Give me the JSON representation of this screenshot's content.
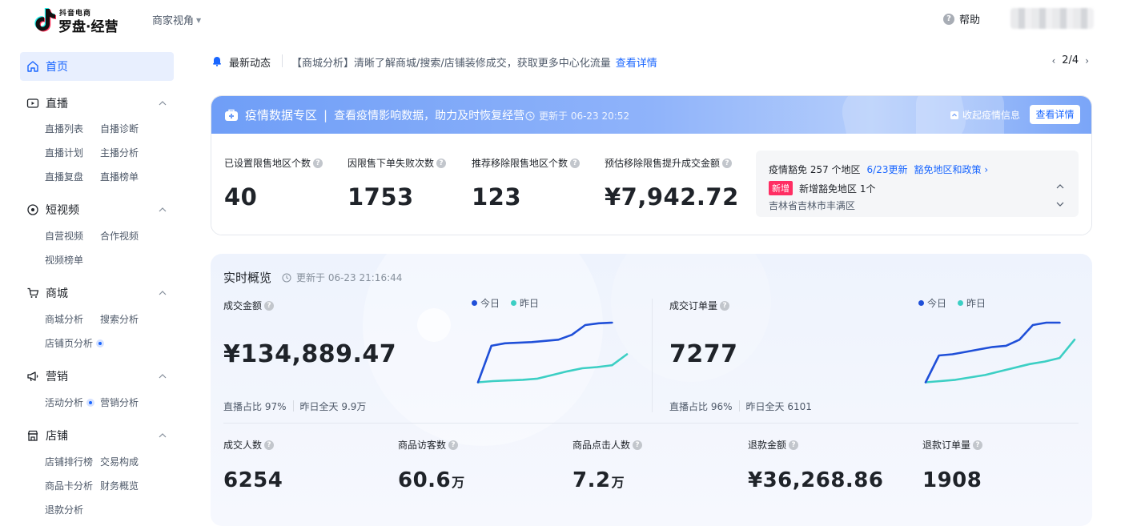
{
  "header": {
    "logo_top": "抖音电商",
    "logo_main": "罗盘·经营",
    "view_switch": "商家视角",
    "help": "帮助"
  },
  "sidebar": {
    "home": "首页",
    "groups": [
      {
        "title": "直播",
        "icon": "tv-icon",
        "items": [
          "直播列表",
          "自播诊断",
          "直播计划",
          "主播分析",
          "直播复盘",
          "直播榜单"
        ]
      },
      {
        "title": "短视频",
        "icon": "video-icon",
        "items": [
          "自营视频",
          "合作视频",
          "视频榜单"
        ]
      },
      {
        "title": "商城",
        "icon": "cart-icon",
        "items": [
          "商城分析",
          "搜索分析",
          "店铺页分析"
        ]
      },
      {
        "title": "营销",
        "icon": "megaphone-icon",
        "items": [
          "活动分析",
          "营销分析"
        ]
      },
      {
        "title": "店铺",
        "icon": "shop-icon",
        "items": [
          "店铺排行榜",
          "交易构成",
          "商品卡分析",
          "财务概览",
          "退款分析"
        ]
      }
    ]
  },
  "news": {
    "label": "最新动态",
    "text": "【商城分析】清晰了解商城/搜索/店铺装修成交，获取更多中心化流量",
    "link": "查看详情",
    "pager": "2/4"
  },
  "epidemic": {
    "title": "疫情数据专区",
    "divider": "|",
    "subtitle": "查看疫情影响数据，助力及时恢复经营",
    "updated": "更新于 06-23 20:52",
    "collapse": "收起疫情信息",
    "detail": "查看详情",
    "metrics": [
      {
        "label": "已设置限售地区个数",
        "value": "40"
      },
      {
        "label": "因限售下单失败次数",
        "value": "1753"
      },
      {
        "label": "推荐移除限售地区个数",
        "value": "123"
      },
      {
        "label": "预估移除限售提升成交金额",
        "value": "¥7,942.72"
      }
    ],
    "exempt": {
      "summary": "疫情豁免 257 个地区",
      "update": "6/23更新",
      "policy": "豁免地区和政策 ›",
      "tag": "新增",
      "added": "新增豁免地区 1个",
      "region": "吉林省吉林市丰满区"
    }
  },
  "realtime": {
    "title": "实时概览",
    "updated": "更新于 06-23 21:16:44",
    "legend_today": "今日",
    "legend_yesterday": "昨日",
    "colors": {
      "today": "#1f4fd8",
      "yesterday": "#3ccfc4"
    },
    "big_cards": [
      {
        "label": "成交金额",
        "value": "¥134,889.47",
        "foot1": "直播占比 97%",
        "foot2": "昨日全天 9.9万",
        "today": [
          0.02,
          0.62,
          0.66,
          0.67,
          0.68,
          0.7,
          0.72,
          0.8,
          0.96,
          0.99,
          1.0
        ],
        "yesterday": [
          0.02,
          0.04,
          0.05,
          0.06,
          0.08,
          0.14,
          0.2,
          0.25,
          0.27,
          0.3,
          0.48
        ]
      },
      {
        "label": "成交订单量",
        "value": "7277",
        "foot1": "直播占比 96%",
        "foot2": "昨日全天 6101",
        "today": [
          0.02,
          0.46,
          0.48,
          0.52,
          0.56,
          0.6,
          0.62,
          0.72,
          0.96,
          1.0,
          1.0
        ],
        "yesterday": [
          0.02,
          0.04,
          0.06,
          0.1,
          0.14,
          0.2,
          0.26,
          0.32,
          0.36,
          0.42,
          0.72
        ]
      }
    ],
    "small_cards": [
      {
        "label": "成交人数",
        "value": "6254",
        "unit": ""
      },
      {
        "label": "商品访客数",
        "value": "60.6",
        "unit": "万"
      },
      {
        "label": "商品点击人数",
        "value": "7.2",
        "unit": "万"
      },
      {
        "label": "退款金额",
        "value": "¥36,268.86",
        "unit": ""
      },
      {
        "label": "退款订单量",
        "value": "1908",
        "unit": ""
      }
    ]
  }
}
